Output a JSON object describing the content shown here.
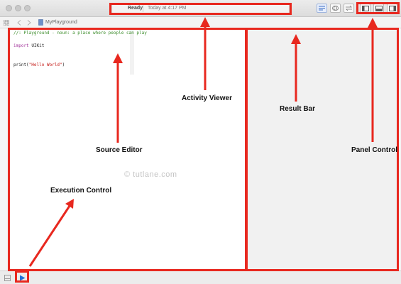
{
  "window": {
    "activity": {
      "status": "Ready",
      "time": "Today at 4:17 PM"
    },
    "navigator": {
      "file": "MyPlayground"
    }
  },
  "editor": {
    "lines": [
      {
        "kind": "comment",
        "text": "//: Playground - noun: a place where people can play"
      },
      {
        "kind": "blank",
        "text": ""
      },
      {
        "kind": "import",
        "keyword": "import",
        "module": "UIKit"
      },
      {
        "kind": "blank",
        "text": ""
      },
      {
        "kind": "blank",
        "text": ""
      },
      {
        "kind": "print",
        "func": "print(",
        "string": "\"Hello World\"",
        "close": ")"
      }
    ]
  },
  "callouts": {
    "activity_viewer": "Activity Viewer",
    "result_bar": "Result Bar",
    "source_editor": "Source Editor",
    "panel_control": "Panel Control",
    "execution_control": "Execution Control"
  },
  "watermark": "© tutlane.com",
  "icons": {
    "close": "traffic-light-icon",
    "standard_editor": "standard-editor-icon",
    "assistant_editor": "assistant-editor-icon",
    "version_editor": "version-editor-icon",
    "navigator_panel": "navigator-panel-icon",
    "debug_panel": "debug-panel-icon",
    "utilities_panel": "utilities-panel-icon",
    "run": "play-icon"
  },
  "colors": {
    "callout_red": "#e8281f",
    "comment_green": "#3b8c2a",
    "keyword_purple": "#a4379c",
    "string_red": "#c41a16",
    "run_blue": "#1e6fd9"
  }
}
